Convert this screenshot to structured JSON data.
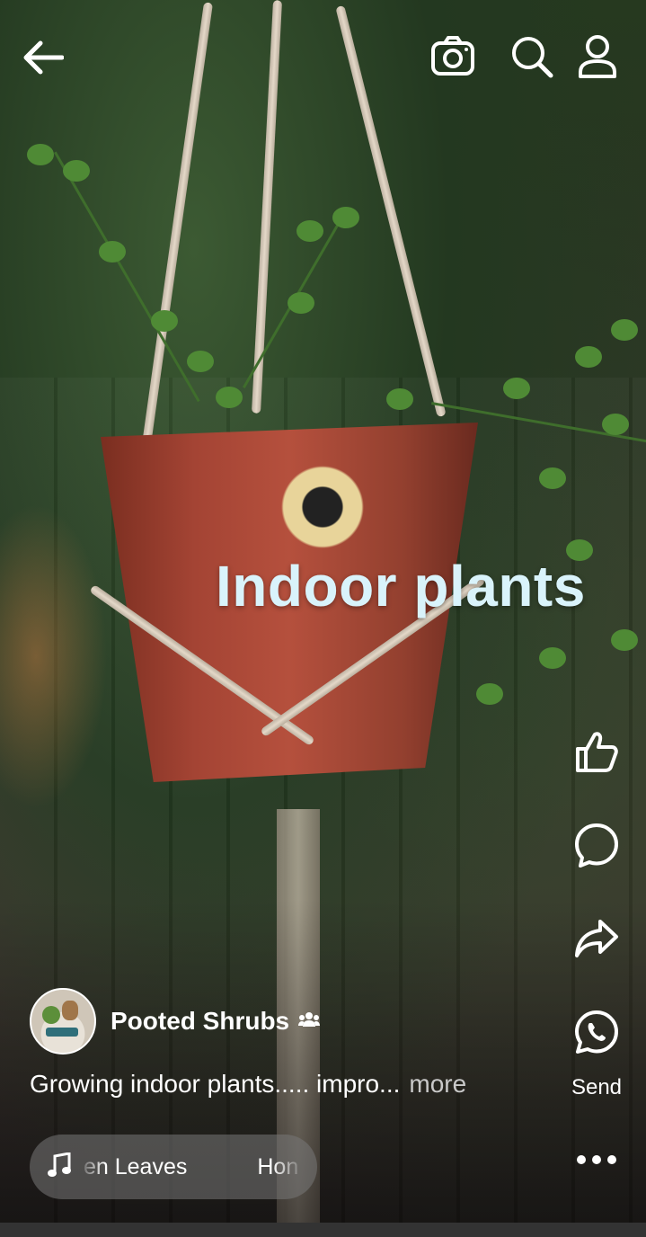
{
  "video": {
    "overlay_text": "Indoor plants"
  },
  "top_bar": {
    "back_icon": "back-arrow-icon",
    "camera_icon": "camera-icon",
    "search_icon": "search-icon",
    "profile_icon": "profile-icon"
  },
  "actions": {
    "like_icon": "thumbs-up-icon",
    "comment_icon": "comment-icon",
    "share_icon": "share-arrow-icon",
    "send_icon": "whatsapp-icon",
    "send_label": "Send",
    "more_icon": "more-dots-icon"
  },
  "author": {
    "name": "Pooted Shrubs",
    "badge_icon": "group-icon"
  },
  "caption": {
    "text": "Growing indoor plants..... impro...",
    "more_label": "more"
  },
  "music": {
    "icon": "music-note-icon",
    "track_title": "en Leaves",
    "track_next": "Hon"
  },
  "colors": {
    "overlay_text": "#d9f3fb",
    "music_pill": "#787878"
  }
}
